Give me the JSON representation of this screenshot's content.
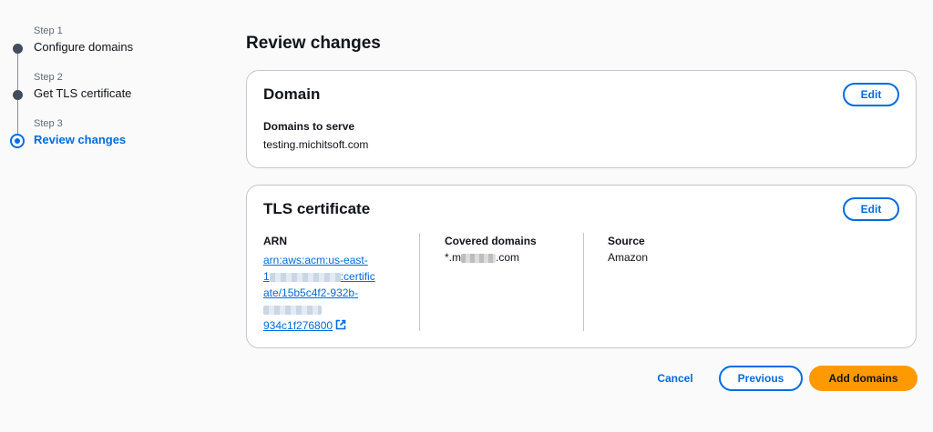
{
  "steps": [
    {
      "sub": "Step 1",
      "title": "Configure domains",
      "state": "complete"
    },
    {
      "sub": "Step 2",
      "title": "Get TLS certificate",
      "state": "complete"
    },
    {
      "sub": "Step 3",
      "title": "Review changes",
      "state": "active"
    }
  ],
  "page_title": "Review changes",
  "domain_card": {
    "title": "Domain",
    "edit_label": "Edit",
    "domains_label": "Domains to serve",
    "domains_value": "testing.michitsoft.com"
  },
  "tls_card": {
    "title": "TLS certificate",
    "edit_label": "Edit",
    "arn_label": "ARN",
    "arn_line1": "arn:aws:acm:us-east-",
    "arn_line2_prefix": "1",
    "arn_line2_suffix": ":certific",
    "arn_line3": "ate/15b5c4f2-932b-",
    "arn_line5": "934c1f276800",
    "covered_label": "Covered domains",
    "covered_prefix": "*.m",
    "covered_suffix": ".com",
    "source_label": "Source",
    "source_value": "Amazon"
  },
  "actions": {
    "cancel": "Cancel",
    "previous": "Previous",
    "submit": "Add domains"
  },
  "colors": {
    "accent": "#006ce0",
    "primary_button": "#ff9900",
    "border": "#c6c6cd"
  },
  "icons": {
    "external_link": "external-link-icon"
  }
}
